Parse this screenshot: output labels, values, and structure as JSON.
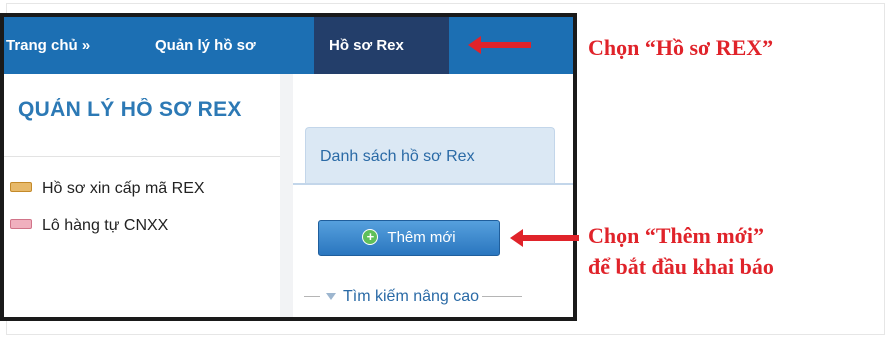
{
  "navbar": {
    "home": "Trang chủ »",
    "manage": "Quản lý hồ sơ",
    "active_tab": "Hồ sơ Rex"
  },
  "sidebar": {
    "heading": "QUẢN LÝ HỒ SƠ REX",
    "items": [
      {
        "icon": "new-badge-icon",
        "label": "Hồ sơ xin cấp mã REX"
      },
      {
        "icon": "new-badge-icon",
        "label": "Lô hàng tự CNXX"
      }
    ]
  },
  "content": {
    "tab_label": "Danh sách hồ sơ Rex",
    "add_button": "Thêm mới",
    "advanced_search": "Tìm kiếm nâng cao"
  },
  "annotations": {
    "callout_1": "Chọn “Hồ sơ REX”",
    "callout_2_line_1": "Chọn “Thêm mới”",
    "callout_2_line_2": "để bắt đầu khai báo"
  },
  "colors": {
    "navbar": "#1c6fb3",
    "navbar_active": "#233e6a",
    "accent_text": "#2c79b5",
    "annotation": "#e0232a"
  }
}
